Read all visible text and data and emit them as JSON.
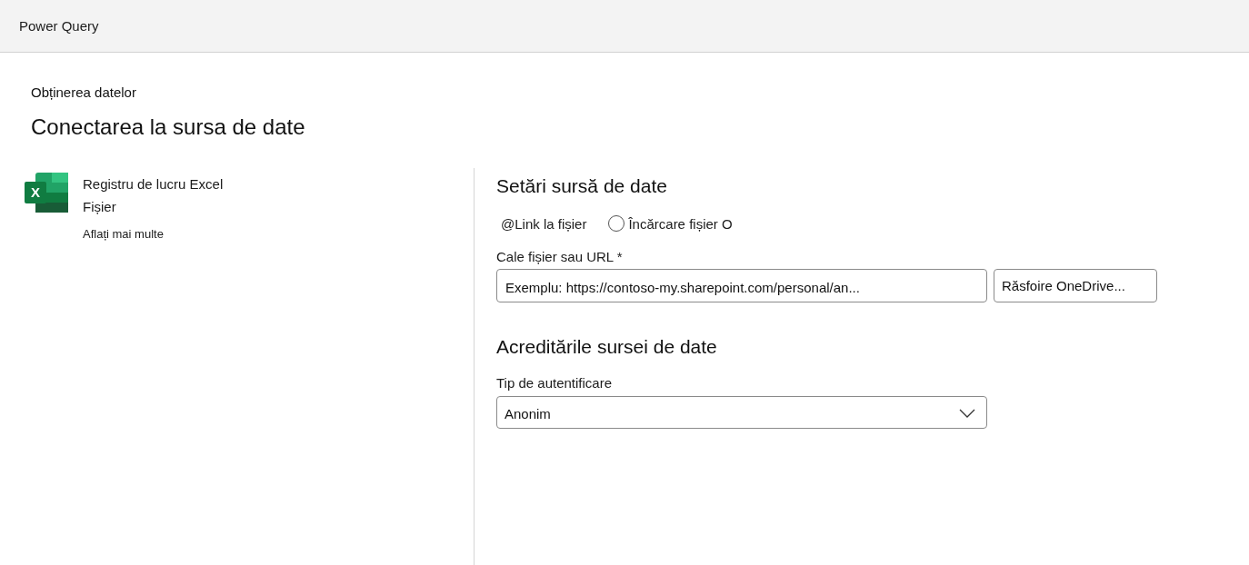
{
  "header": {
    "title": "Power Query"
  },
  "page": {
    "breadcrumb": "Obținerea datelor",
    "title": "Conectarea la sursa de date"
  },
  "source": {
    "icon_letter": "X",
    "name": "Registru de lucru Excel",
    "category": "Fișier",
    "link": "Aflați mai multe"
  },
  "settings": {
    "title": "Setări sursă de date",
    "options": [
      {
        "kind": "text",
        "label": "@Link la fișier"
      },
      {
        "kind": "radio",
        "label": "Încărcare fișier O",
        "selected": false
      }
    ],
    "path_field": {
      "label": "Cale fișier sau URL *",
      "placeholder": "Exemplu: https://contoso-my.sharepoint.com/personal/an..."
    },
    "browse_button": "Răsfoire OneDrive..."
  },
  "credentials": {
    "title": "Acreditările sursei de date",
    "auth_label": "Tip de autentificare",
    "auth_value": "Anonim"
  }
}
